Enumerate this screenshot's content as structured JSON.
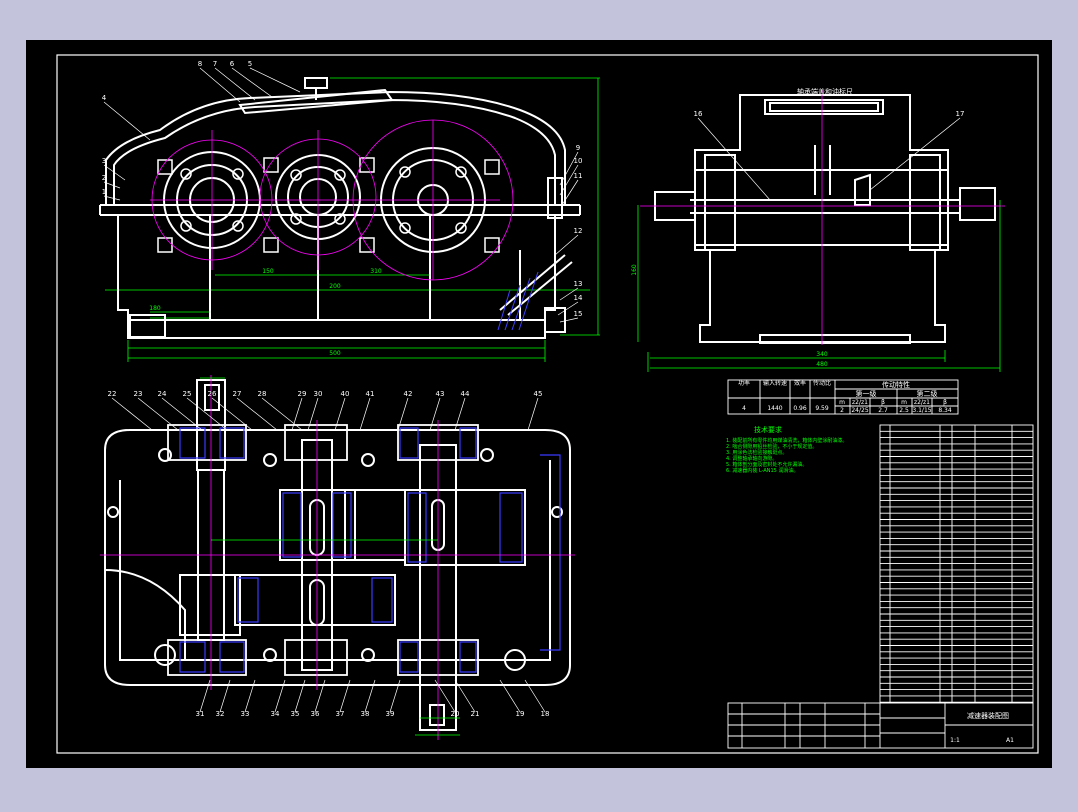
{
  "drawing": {
    "background": "#000000",
    "frame_color": "#c3c3dc",
    "line_color": "#ffffff",
    "center_color": "#ff00ff",
    "dim_color": "#00ff00",
    "section_color": "#0000ff",
    "sheet_title": "减速器装配图",
    "view_title": "轴承端盖和油标尺",
    "front_balloons": [
      "8",
      "7",
      "6",
      "5",
      "4",
      "3",
      "2",
      "1",
      "9",
      "10",
      "11",
      "12",
      "13",
      "14",
      "15"
    ],
    "side_balloons": [
      "16",
      "17"
    ],
    "plan_top_balloons": [
      "22",
      "23",
      "24",
      "25",
      "26",
      "27",
      "28",
      "29",
      "30",
      "40",
      "41",
      "42",
      "43",
      "44",
      "45"
    ],
    "plan_bottom_balloons": [
      "31",
      "32",
      "33",
      "34",
      "35",
      "36",
      "37",
      "38",
      "39",
      "20",
      "21",
      "19",
      "18"
    ],
    "spec_table": {
      "headers": [
        "功率",
        "输入转速",
        "效率",
        "传动比"
      ],
      "row": [
        "4",
        "1440",
        "0.96",
        "9.59"
      ],
      "group_title": "传动特性",
      "stage1": "第一级",
      "stage2": "第二级",
      "sub": [
        "m",
        "z2/z1",
        "β",
        "m",
        "z2/z1",
        "β"
      ],
      "vals": [
        "2",
        "24/25",
        "2.7",
        "2.5",
        "3.1/15",
        "8.34"
      ]
    },
    "tech_title": "技术要求",
    "tech_lines": [
      "1. 装配前所有零件均用煤油清洗，箱体内壁涂耐油漆。",
      "2. 啮合侧隙用铅丝检验，不小于规定值。",
      "3. 用涂色法检验接触斑点。",
      "4. 调整轴承轴向游隙。",
      "5. 箱体剖分面及密封处不允许漏油。",
      "6. 减速器内装 L-AN15 润滑油。"
    ],
    "dims": [
      "180",
      "150",
      "310",
      "200",
      "500",
      "340",
      "480",
      "160"
    ],
    "title_block": {
      "name": "减速器装配图",
      "scale": "1:1",
      "sheet": "A1"
    }
  }
}
